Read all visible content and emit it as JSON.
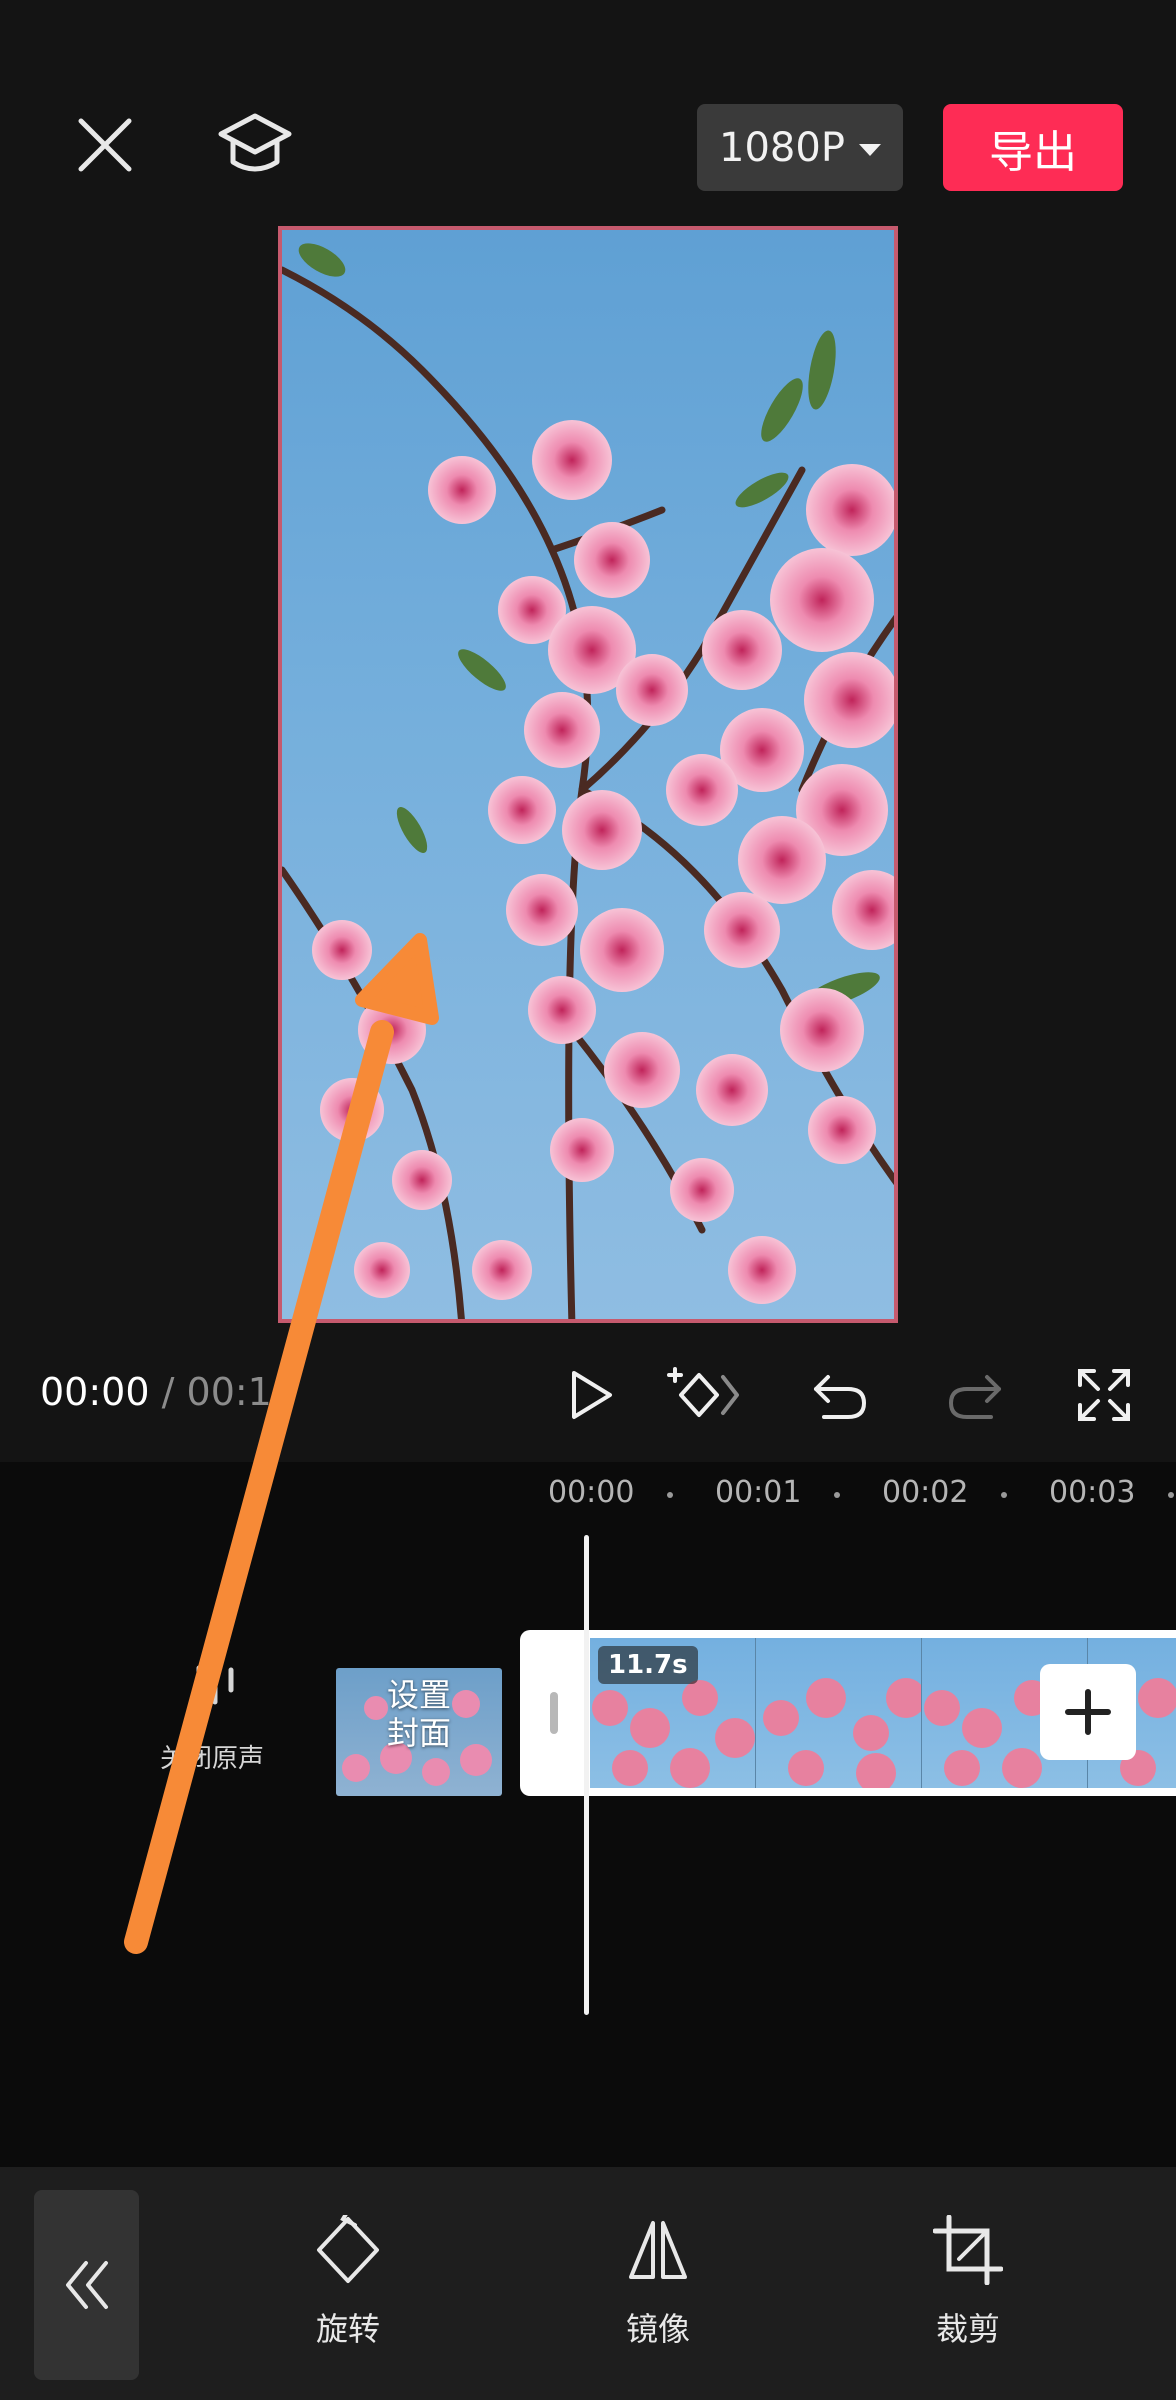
{
  "header": {
    "resolution_label": "1080P",
    "export_label": "导出"
  },
  "player": {
    "current_time": "00:00",
    "separator": "/",
    "total_time": "00:11"
  },
  "timeline": {
    "ruler": [
      "00:00",
      "00:01",
      "00:02",
      "00:03"
    ],
    "mute_label": "关闭原声",
    "cover_label_line1": "设置",
    "cover_label_line2": "封面",
    "clip_duration": "11.7s"
  },
  "toolbar": {
    "items": [
      {
        "label": "旋转",
        "icon": "rotate-icon"
      },
      {
        "label": "镜像",
        "icon": "mirror-icon"
      },
      {
        "label": "裁剪",
        "icon": "crop-icon"
      }
    ]
  },
  "colors": {
    "accent": "#fe2c55",
    "annotation_arrow": "#f78a37"
  }
}
